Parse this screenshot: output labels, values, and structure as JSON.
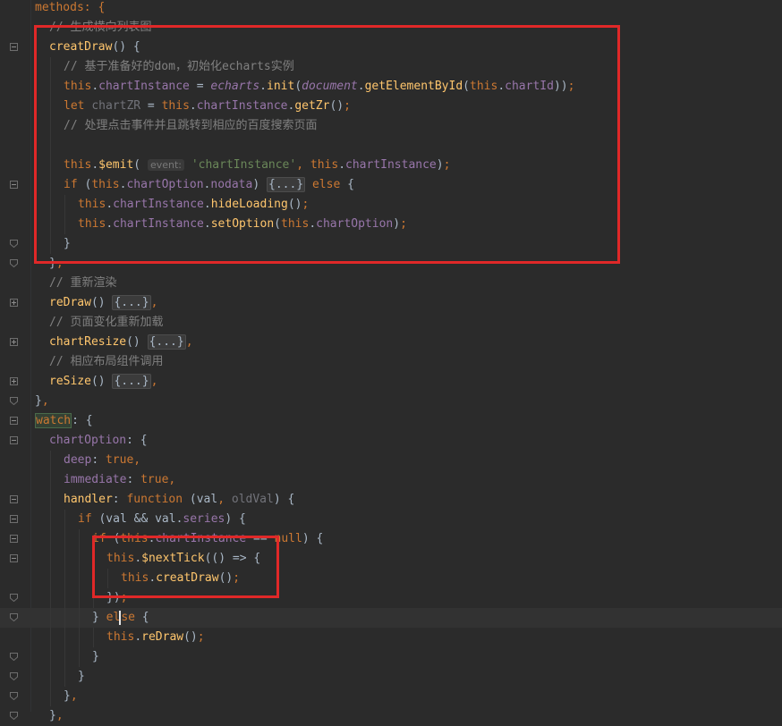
{
  "lines": [
    {
      "indent": 0,
      "fold": "none",
      "tokens": [
        [
          "kw",
          "methods: {"
        ]
      ]
    },
    {
      "indent": 1,
      "fold": "none",
      "tokens": [
        [
          "cmt",
          "// 生成横向列表图"
        ]
      ]
    },
    {
      "indent": 1,
      "fold": "open",
      "tokens": [
        [
          "fn",
          "creatDraw"
        ],
        [
          "plain",
          "() {"
        ]
      ]
    },
    {
      "indent": 2,
      "fold": "none",
      "tokens": [
        [
          "cmt",
          "// 基于准备好的dom，初始化echarts实例"
        ]
      ]
    },
    {
      "indent": 2,
      "fold": "none",
      "tokens": [
        [
          "kw",
          "this"
        ],
        [
          "plain",
          "."
        ],
        [
          "prop",
          "chartInstance"
        ],
        [
          "plain",
          " = "
        ],
        [
          "glob",
          "echarts"
        ],
        [
          "plain",
          "."
        ],
        [
          "fn",
          "init"
        ],
        [
          "plain",
          "("
        ],
        [
          "glob",
          "document"
        ],
        [
          "plain",
          "."
        ],
        [
          "fn",
          "getElementById"
        ],
        [
          "plain",
          "("
        ],
        [
          "kw",
          "this"
        ],
        [
          "plain",
          "."
        ],
        [
          "prop",
          "chartId"
        ],
        [
          "plain",
          "))"
        ],
        [
          "kw",
          ";"
        ]
      ]
    },
    {
      "indent": 2,
      "fold": "none",
      "tokens": [
        [
          "kw",
          "let "
        ],
        [
          "gray",
          "chartZR"
        ],
        [
          "plain",
          " = "
        ],
        [
          "kw",
          "this"
        ],
        [
          "plain",
          "."
        ],
        [
          "prop",
          "chartInstance"
        ],
        [
          "plain",
          "."
        ],
        [
          "fn",
          "getZr"
        ],
        [
          "plain",
          "()"
        ],
        [
          "kw",
          ";"
        ]
      ]
    },
    {
      "indent": 2,
      "fold": "none",
      "tokens": [
        [
          "cmt",
          "// 处理点击事件并且跳转到相应的百度搜索页面"
        ]
      ]
    },
    {
      "indent": 2,
      "fold": "none",
      "tokens": []
    },
    {
      "indent": 2,
      "fold": "none",
      "tokens": [
        [
          "kw",
          "this"
        ],
        [
          "plain",
          "."
        ],
        [
          "fn",
          "$emit"
        ],
        [
          "plain",
          "( "
        ],
        [
          "hint",
          "event:"
        ],
        [
          "plain",
          " "
        ],
        [
          "str",
          "'chartInstance'"
        ],
        [
          "kw",
          ", "
        ],
        [
          "kw",
          "this"
        ],
        [
          "plain",
          "."
        ],
        [
          "prop",
          "chartInstance"
        ],
        [
          "plain",
          ")"
        ],
        [
          "kw",
          ";"
        ]
      ]
    },
    {
      "indent": 2,
      "fold": "open",
      "tokens": [
        [
          "kw",
          "if "
        ],
        [
          "plain",
          "("
        ],
        [
          "kw",
          "this"
        ],
        [
          "plain",
          "."
        ],
        [
          "prop",
          "chartOption"
        ],
        [
          "plain",
          "."
        ],
        [
          "prop",
          "nodata"
        ],
        [
          "plain",
          ") "
        ],
        [
          "box",
          "{...}"
        ],
        [
          "kw",
          " else "
        ],
        [
          "plain",
          "{"
        ]
      ]
    },
    {
      "indent": 3,
      "fold": "none",
      "tokens": [
        [
          "kw",
          "this"
        ],
        [
          "plain",
          "."
        ],
        [
          "prop",
          "chartInstance"
        ],
        [
          "plain",
          "."
        ],
        [
          "fn",
          "hideLoading"
        ],
        [
          "plain",
          "()"
        ],
        [
          "kw",
          ";"
        ]
      ]
    },
    {
      "indent": 3,
      "fold": "none",
      "tokens": [
        [
          "kw",
          "this"
        ],
        [
          "plain",
          "."
        ],
        [
          "prop",
          "chartInstance"
        ],
        [
          "plain",
          "."
        ],
        [
          "fn",
          "setOption"
        ],
        [
          "plain",
          "("
        ],
        [
          "kw",
          "this"
        ],
        [
          "plain",
          "."
        ],
        [
          "prop",
          "chartOption"
        ],
        [
          "plain",
          ")"
        ],
        [
          "kw",
          ";"
        ]
      ]
    },
    {
      "indent": 2,
      "fold": "close",
      "tokens": [
        [
          "plain",
          "}"
        ]
      ]
    },
    {
      "indent": 1,
      "fold": "close",
      "tokens": [
        [
          "plain",
          "}"
        ],
        [
          "kw",
          ","
        ]
      ]
    },
    {
      "indent": 1,
      "fold": "none",
      "tokens": [
        [
          "cmt",
          "// 重新渲染"
        ]
      ]
    },
    {
      "indent": 1,
      "fold": "closed",
      "tokens": [
        [
          "fn",
          "reDraw"
        ],
        [
          "plain",
          "() "
        ],
        [
          "box",
          "{...}"
        ],
        [
          "kw",
          ","
        ]
      ]
    },
    {
      "indent": 1,
      "fold": "none",
      "tokens": [
        [
          "cmt",
          "// 页面变化重新加载"
        ]
      ]
    },
    {
      "indent": 1,
      "fold": "closed",
      "tokens": [
        [
          "fn",
          "chartResize"
        ],
        [
          "plain",
          "() "
        ],
        [
          "box",
          "{...}"
        ],
        [
          "kw",
          ","
        ]
      ]
    },
    {
      "indent": 1,
      "fold": "none",
      "tokens": [
        [
          "cmt",
          "// 相应布局组件调用"
        ]
      ]
    },
    {
      "indent": 1,
      "fold": "closed",
      "tokens": [
        [
          "fn",
          "reSize"
        ],
        [
          "plain",
          "() "
        ],
        [
          "box",
          "{...}"
        ],
        [
          "kw",
          ","
        ]
      ]
    },
    {
      "indent": 0,
      "fold": "close",
      "tokens": [
        [
          "plain",
          "}"
        ],
        [
          "kw",
          ","
        ]
      ]
    },
    {
      "indent": 0,
      "fold": "open",
      "tokens": [
        [
          "watch",
          "watch"
        ],
        [
          "plain",
          ": {"
        ]
      ]
    },
    {
      "indent": 1,
      "fold": "open",
      "tokens": [
        [
          "prop",
          "chartOption"
        ],
        [
          "plain",
          ": {"
        ]
      ]
    },
    {
      "indent": 2,
      "fold": "none",
      "tokens": [
        [
          "prop",
          "deep"
        ],
        [
          "plain",
          ": "
        ],
        [
          "kw",
          "true,"
        ]
      ]
    },
    {
      "indent": 2,
      "fold": "none",
      "tokens": [
        [
          "prop",
          "immediate"
        ],
        [
          "plain",
          ": "
        ],
        [
          "kw",
          "true,"
        ]
      ]
    },
    {
      "indent": 2,
      "fold": "open",
      "tokens": [
        [
          "fn",
          "handler"
        ],
        [
          "plain",
          ": "
        ],
        [
          "kw",
          "function "
        ],
        [
          "plain",
          "("
        ],
        [
          "plain",
          "val"
        ],
        [
          "kw",
          ", "
        ],
        [
          "gray",
          "oldVal"
        ],
        [
          "plain",
          ") {"
        ]
      ]
    },
    {
      "indent": 3,
      "fold": "open",
      "tokens": [
        [
          "kw",
          "if "
        ],
        [
          "plain",
          "(val && val."
        ],
        [
          "prop",
          "series"
        ],
        [
          "plain",
          ") {"
        ]
      ]
    },
    {
      "indent": 4,
      "fold": "open",
      "tokens": [
        [
          "kw",
          "if "
        ],
        [
          "plain",
          "("
        ],
        [
          "kw",
          "this"
        ],
        [
          "plain",
          "."
        ],
        [
          "prop",
          "chartInstance"
        ],
        [
          "plain",
          " == "
        ],
        [
          "kw",
          "null"
        ],
        [
          "plain",
          ") {"
        ]
      ]
    },
    {
      "indent": 5,
      "fold": "open",
      "tokens": [
        [
          "kw",
          "this"
        ],
        [
          "plain",
          "."
        ],
        [
          "fn",
          "$nextTick"
        ],
        [
          "plain",
          "(() => {"
        ]
      ]
    },
    {
      "indent": 6,
      "fold": "none",
      "tokens": [
        [
          "kw",
          "this"
        ],
        [
          "plain",
          "."
        ],
        [
          "fn",
          "creatDraw"
        ],
        [
          "plain",
          "()"
        ],
        [
          "kw",
          ";"
        ]
      ]
    },
    {
      "indent": 5,
      "fold": "close",
      "tokens": [
        [
          "plain",
          "})"
        ],
        [
          "kw",
          ";"
        ]
      ]
    },
    {
      "indent": 4,
      "fold": "close",
      "current": true,
      "tokens": [
        [
          "plain",
          "} "
        ],
        [
          "kw",
          "el"
        ],
        [
          "caret",
          ""
        ],
        [
          "kw",
          "se "
        ],
        [
          "plain",
          "{"
        ]
      ]
    },
    {
      "indent": 5,
      "fold": "none",
      "tokens": [
        [
          "kw",
          "this"
        ],
        [
          "plain",
          "."
        ],
        [
          "fn",
          "reDraw"
        ],
        [
          "plain",
          "()"
        ],
        [
          "kw",
          ";"
        ]
      ]
    },
    {
      "indent": 4,
      "fold": "close",
      "tokens": [
        [
          "plain",
          "}"
        ]
      ]
    },
    {
      "indent": 3,
      "fold": "close",
      "tokens": [
        [
          "plain",
          "}"
        ]
      ]
    },
    {
      "indent": 2,
      "fold": "close",
      "tokens": [
        [
          "plain",
          "}"
        ],
        [
          "kw",
          ","
        ]
      ]
    },
    {
      "indent": 1,
      "fold": "close",
      "tokens": [
        [
          "plain",
          "}"
        ],
        [
          "kw",
          ","
        ]
      ]
    }
  ],
  "colors": {
    "background": "#2b2b2b",
    "keyword": "#cc7832",
    "function": "#ffc66d",
    "property": "#9876aa",
    "string": "#6a8759",
    "comment": "#808080",
    "text": "#a9b7c6",
    "annotation_box": "#e02828"
  }
}
